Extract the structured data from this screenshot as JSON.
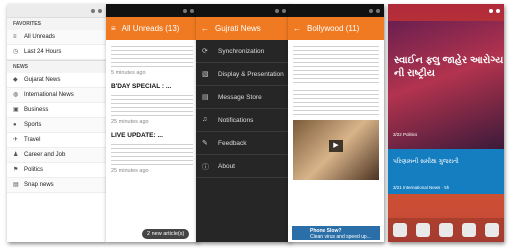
{
  "drawer": {
    "favorites_header": "FAVORITES",
    "favorites": [
      "All Unreads",
      "Last 24 Hours"
    ],
    "news_header": "NEWS",
    "news": [
      "Gujarat News",
      "International News",
      "Business",
      "Sports",
      "Travel",
      "Career and Job",
      "Politics",
      "Snap news"
    ]
  },
  "unreads": {
    "title": "All Unreads (13)",
    "articles": [
      {
        "title": "",
        "time": "5 minutes ago"
      },
      {
        "title": "B'DAY SPECIAL : ...",
        "time": "25 minutes ago"
      },
      {
        "title": "LIVE UPDATE: ...",
        "time": "25 minutes ago"
      }
    ],
    "new_button": "2 new article(s)"
  },
  "menu": {
    "title": "Gujrati News",
    "items": [
      "Synchronization",
      "Display & Presentation",
      "Message Store",
      "Notifications",
      "Feedback",
      "About"
    ]
  },
  "bollywood": {
    "title": "Bollywood (11)",
    "ad_text": "Phone Slow?",
    "ad_sub": "Clean virus and speed up..."
  },
  "lock": {
    "headline": "સ્વાઈન ફ્લુ જાહેર આરોગ્ય ની રાષ્ટ્રીય",
    "card_text": "પરિણામની સમીક્ષા ગુજરાતી",
    "meta1": "3/22  Politics",
    "meta2": "3/21  International News · 5h"
  }
}
